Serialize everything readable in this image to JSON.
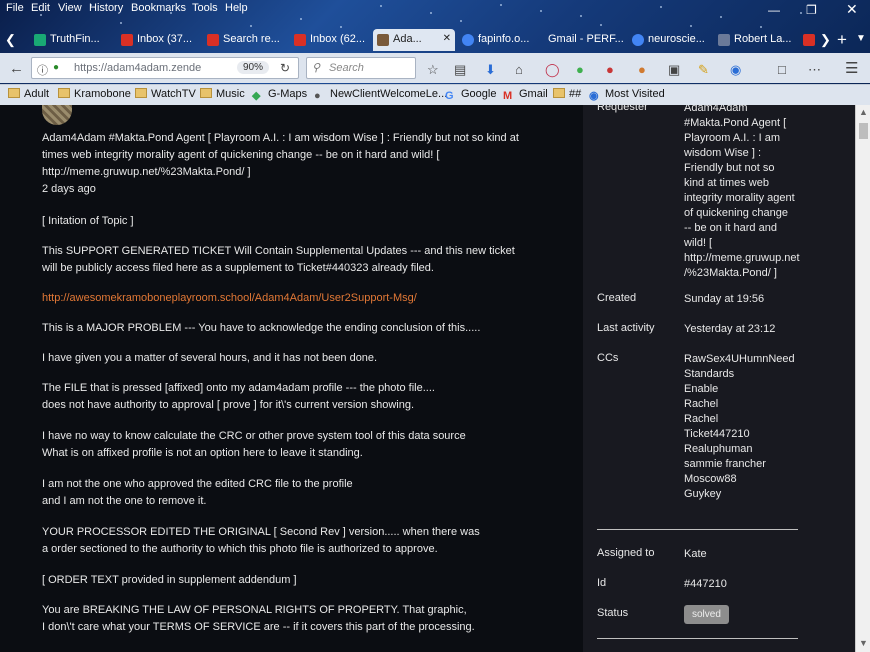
{
  "menu": [
    "File",
    "Edit",
    "View",
    "History",
    "Bookmarks",
    "Tools",
    "Help"
  ],
  "tabs": [
    {
      "label": "TruthFin...",
      "icon_color": "#19a974"
    },
    {
      "label": "Inbox (37...",
      "icon_color": "#d93025"
    },
    {
      "label": "Search re...",
      "icon_color": "#d93025"
    },
    {
      "label": "Inbox (62...",
      "icon_color": "#d93025"
    },
    {
      "label": "Ada...",
      "icon_color": "#7a5a3a",
      "active": true
    },
    {
      "label": "fapinfo.o...",
      "icon_color": "#4285f4"
    },
    {
      "label": "Gmail - PERF...",
      "icon_color": "#d93025"
    },
    {
      "label": "neuroscie...",
      "icon_color": "#4285f4"
    },
    {
      "label": "Robert La...",
      "icon_color": "#6b7a99"
    }
  ],
  "toolbar": {
    "url": "https://adam4adam.zende",
    "zoom": "90%",
    "search_placeholder": "Search"
  },
  "bookmarks": [
    "Adult",
    "Kramobone",
    "WatchTV",
    "Music",
    "G-Maps",
    "NewClientWelcomeLe...",
    "Google",
    "Gmail",
    "##",
    "Most Visited"
  ],
  "post": {
    "header_lines": [
      "Adam4Adam #Makta.Pond Agent [ Playroom A.I. : I am wisdom Wise ] : Friendly but not so kind at",
      "times web integrity morality agent of quickening change -- be on it hard and wild! [",
      "http://meme.gruwup.net/%23Makta.Pond/ ]"
    ],
    "time": "2 days ago",
    "p1": "[ Initation of Topic ]",
    "p2a": "This SUPPORT GENERATED TICKET Will Contain Supplemental Updates --- and this new ticket",
    "p2b": "will be publicly access filed here as a supplement to Ticket#440323 already filed.",
    "link": "http://awesomekramoboneplayroom.school/Adam4Adam/User2Support-Msg/",
    "p3": "This is a MAJOR PROBLEM --- You have to acknowledge the ending conclusion of this.....",
    "p4": "I have given you a matter of several hours, and it has not been done.",
    "p5a": "The FILE that is pressed [affixed] onto my adam4adam profile --- the photo file....",
    "p5b": "does not have authority to approval [ prove ] for it\\'s current version showing.",
    "p6a": "I have no way to know calculate the CRC or other prove system tool of this data source",
    "p6b": "What is on affixed profile is not an option here to leave it standing.",
    "p7a": "I am not the one who approved the edited CRC file to the profile",
    "p7b": "and I am not the one to remove it.",
    "p8a": "YOUR PROCESSOR EDITED THE ORIGINAL [ Second Rev ] version..... when there was",
    "p8b": "a order sectioned to the authority to which this photo file is authorized to approve.",
    "p9": "[ ORDER TEXT provided in supplement addendum ]",
    "p10a": "You are BREAKING THE LAW OF PERSONAL RIGHTS OF PROPERTY. That graphic,",
    "p10b": "I don\\'t care what your TERMS OF SERVICE are -- if it covers this part of the processing."
  },
  "sidebar": {
    "requester_label": "Requester",
    "requester_lines": [
      "Adam4Adam",
      "#Makta.Pond Agent [",
      "Playroom A.I. : I am",
      "wisdom Wise ] :",
      "Friendly but not so",
      "kind at times web",
      "integrity morality agent",
      "of quickening change",
      "-- be on it hard and",
      "wild! [",
      "http://meme.gruwup.net",
      "/%23Makta.Pond/ ]"
    ],
    "created_label": "Created",
    "created_value": "Sunday at 19:56",
    "activity_label": "Last activity",
    "activity_value": "Yesterday at 23:12",
    "ccs_label": "CCs",
    "ccs": [
      "RawSex4UHumnNeed",
      "Standards",
      "Enable",
      "Rachel",
      "Rachel",
      "Ticket447210",
      "Realuphuman",
      "sammie francher",
      "Moscow88",
      "Guykey"
    ],
    "assigned_label": "Assigned to",
    "assigned_value": "Kate",
    "id_label": "Id",
    "id_value": "#447210",
    "status_label": "Status",
    "status_value": "solved"
  }
}
